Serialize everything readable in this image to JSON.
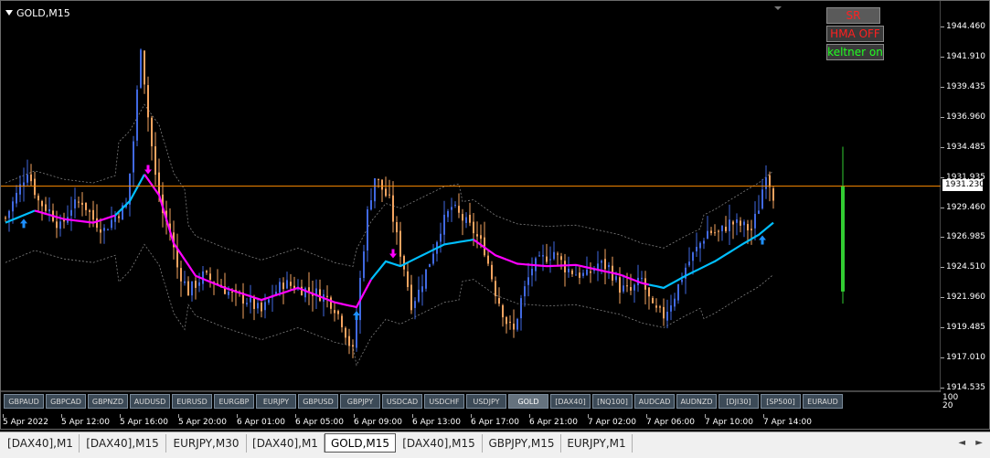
{
  "window": {
    "symbol_title": "GOLD,M15"
  },
  "indicator_buttons": {
    "sr": "SR",
    "hma": "HMA OFF",
    "keltner": "keltner on"
  },
  "price_axis": {
    "labels": [
      "1944.460",
      "1941.910",
      "1939.435",
      "1936.960",
      "1934.485",
      "1931.935",
      "1929.460",
      "1926.985",
      "1924.510",
      "1921.960",
      "1919.485",
      "1917.010",
      "1914.535"
    ],
    "current_price": "1931.230"
  },
  "subwindow_scale": {
    "top": "100",
    "bottom": "20"
  },
  "time_axis": {
    "labels": [
      "5 Apr 2022",
      "5 Apr 12:00",
      "5 Apr 16:00",
      "5 Apr 20:00",
      "6 Apr 01:00",
      "6 Apr 05:00",
      "6 Apr 09:00",
      "6 Apr 13:00",
      "6 Apr 17:00",
      "6 Apr 21:00",
      "7 Apr 02:00",
      "7 Apr 06:00",
      "7 Apr 10:00",
      "7 Apr 14:00"
    ]
  },
  "symbol_buttons": {
    "items": [
      "GBPAUD",
      "GBPCAD",
      "GBPNZD",
      "AUDUSD",
      "EURUSD",
      "EURGBP",
      "EURJPY",
      "GBPUSD",
      "GBPJPY",
      "USDCAD",
      "USDCHF",
      "USDJPY",
      "GOLD",
      "[DAX40]",
      "[NQ100]",
      "AUDCAD",
      "AUDNZD",
      "[DJI30]",
      "[SP500]",
      "EURAUD"
    ],
    "active": "GOLD"
  },
  "tabs": {
    "items": [
      "[DAX40],M1",
      "[DAX40],M15",
      "EURJPY,M30",
      "[DAX40],M1",
      "GOLD,M15",
      "[DAX40],M15",
      "GBPJPY,M15",
      "EURJPY,M1"
    ],
    "active_index": 4
  },
  "tab_nav": {
    "prev": "◄",
    "next": "►"
  },
  "chart_data": {
    "type": "candlestick",
    "symbol": "GOLD",
    "timeframe": "M15",
    "ylim": [
      1914.535,
      1944.46
    ],
    "current_price": 1931.23,
    "colors": {
      "background": "#000000",
      "bull_candle": "#4169e1",
      "bear_candle": "#f4a460",
      "ma_bull": "#00bfff",
      "ma_bear": "#ff00ff",
      "keltner": "#808080",
      "price_line": "#ff8c00",
      "signal_bar": "#32cd32",
      "arrow_up": "#1e90ff",
      "arrow_down": "#ff00ff"
    },
    "path": [
      [
        0,
        1928.6
      ],
      [
        3,
        1930.5
      ],
      [
        6,
        1932.6
      ],
      [
        9,
        1930.0
      ],
      [
        12,
        1929.2
      ],
      [
        15,
        1927.8
      ],
      [
        18,
        1929.5
      ],
      [
        21,
        1930.0
      ],
      [
        24,
        1928.5
      ],
      [
        27,
        1927.6
      ],
      [
        30,
        1928.8
      ],
      [
        33,
        1929.6
      ],
      [
        35,
        1935.0
      ],
      [
        37,
        1943.0
      ],
      [
        39,
        1937.0
      ],
      [
        41,
        1932.0
      ],
      [
        43,
        1929.0
      ],
      [
        45,
        1927.5
      ],
      [
        47,
        1924.5
      ],
      [
        50,
        1922.5
      ],
      [
        54,
        1923.8
      ],
      [
        58,
        1923.2
      ],
      [
        62,
        1922.2
      ],
      [
        66,
        1921.8
      ],
      [
        70,
        1920.8
      ],
      [
        73,
        1922.2
      ],
      [
        76,
        1923.2
      ],
      [
        80,
        1922.8
      ],
      [
        84,
        1922.5
      ],
      [
        88,
        1922.0
      ],
      [
        90,
        1921.2
      ],
      [
        92,
        1920.0
      ],
      [
        94,
        1918.2
      ],
      [
        95,
        1917.5
      ],
      [
        96,
        1920.2
      ],
      [
        97,
        1923.5
      ],
      [
        99,
        1929.0
      ],
      [
        101,
        1932.0
      ],
      [
        103,
        1931.0
      ],
      [
        105,
        1930.0
      ],
      [
        107,
        1927.0
      ],
      [
        109,
        1924.5
      ],
      [
        111,
        1921.5
      ],
      [
        113,
        1922.5
      ],
      [
        116,
        1925.0
      ],
      [
        119,
        1927.8
      ],
      [
        122,
        1929.5
      ],
      [
        125,
        1928.5
      ],
      [
        128,
        1927.5
      ],
      [
        131,
        1926.0
      ],
      [
        134,
        1922.5
      ],
      [
        137,
        1920.0
      ],
      [
        139,
        1919.2
      ],
      [
        141,
        1921.8
      ],
      [
        144,
        1924.5
      ],
      [
        147,
        1925.2
      ],
      [
        150,
        1925.8
      ],
      [
        153,
        1924.5
      ],
      [
        156,
        1924.0
      ],
      [
        159,
        1923.8
      ],
      [
        162,
        1924.8
      ],
      [
        165,
        1924.5
      ],
      [
        168,
        1922.8
      ],
      [
        171,
        1922.5
      ],
      [
        174,
        1923.5
      ],
      [
        177,
        1921.0
      ],
      [
        180,
        1920.5
      ],
      [
        183,
        1922.2
      ],
      [
        186,
        1924.5
      ],
      [
        189,
        1926.0
      ],
      [
        192,
        1927.5
      ],
      [
        195,
        1927.3
      ],
      [
        198,
        1928.2
      ],
      [
        201,
        1928.0
      ],
      [
        204,
        1927.6
      ],
      [
        206,
        1929.5
      ],
      [
        208,
        1932.5
      ],
      [
        210,
        1930.5
      ]
    ],
    "ma_points": [
      [
        0,
        1928.2
      ],
      [
        8,
        1929.2
      ],
      [
        16,
        1928.5
      ],
      [
        24,
        1928.2
      ],
      [
        30,
        1928.8
      ],
      [
        34,
        1930.0
      ],
      [
        38,
        1932.2
      ],
      [
        42,
        1930.5
      ],
      [
        46,
        1926.5
      ],
      [
        52,
        1923.8
      ],
      [
        60,
        1922.8
      ],
      [
        70,
        1921.8
      ],
      [
        80,
        1922.8
      ],
      [
        90,
        1921.6
      ],
      [
        96,
        1921.2
      ],
      [
        100,
        1923.5
      ],
      [
        104,
        1925.0
      ],
      [
        108,
        1924.6
      ],
      [
        112,
        1925.2
      ],
      [
        120,
        1926.4
      ],
      [
        128,
        1926.8
      ],
      [
        134,
        1925.5
      ],
      [
        140,
        1924.8
      ],
      [
        148,
        1924.6
      ],
      [
        156,
        1924.7
      ],
      [
        162,
        1924.3
      ],
      [
        168,
        1923.9
      ],
      [
        174,
        1923.2
      ],
      [
        180,
        1922.8
      ],
      [
        186,
        1923.8
      ],
      [
        194,
        1925.0
      ],
      [
        202,
        1926.5
      ],
      [
        206,
        1927.2
      ],
      [
        210,
        1928.2
      ]
    ],
    "ma_segments": [
      {
        "trend": "up",
        "from": 0,
        "to": 8
      },
      {
        "trend": "down",
        "from": 8,
        "to": 30
      },
      {
        "trend": "up",
        "from": 30,
        "to": 38
      },
      {
        "trend": "down",
        "from": 38,
        "to": 100
      },
      {
        "trend": "up",
        "from": 100,
        "to": 128
      },
      {
        "trend": "down",
        "from": 128,
        "to": 176
      },
      {
        "trend": "up",
        "from": 176,
        "to": 211
      }
    ],
    "keltner_width": 3.3,
    "arrows": [
      {
        "bar": 5,
        "dir": "up"
      },
      {
        "bar": 39,
        "dir": "down"
      },
      {
        "bar": 96,
        "dir": "up"
      },
      {
        "bar": 106,
        "dir": "down"
      },
      {
        "bar": 207,
        "dir": "up"
      }
    ],
    "signal_bar": {
      "bar": 229,
      "high": 1934.5,
      "low": 1921.5,
      "top": 1931.2,
      "bottom": 1922.5
    }
  }
}
